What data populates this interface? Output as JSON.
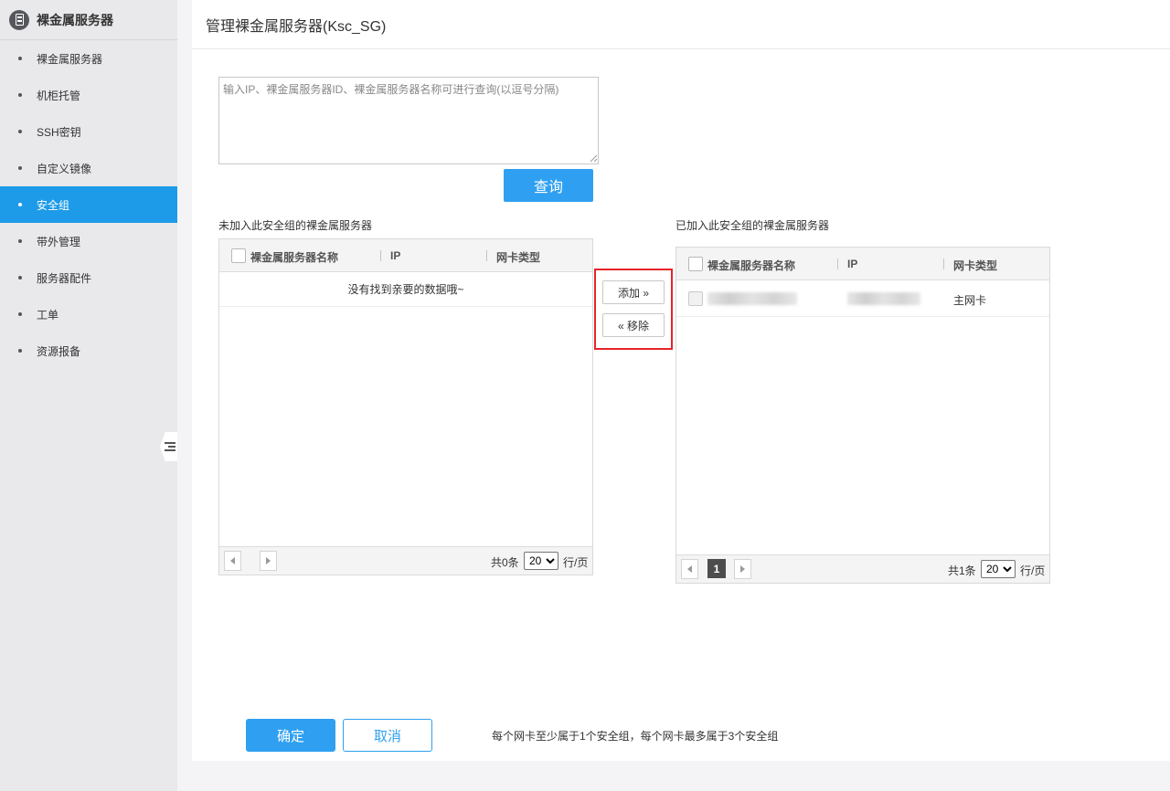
{
  "sidebar": {
    "logo_icon": "server-icon",
    "title": "裸金属服务器",
    "items": [
      {
        "label": "裸金属服务器",
        "active": false
      },
      {
        "label": "机柜托管",
        "active": false
      },
      {
        "label": "SSH密钥",
        "active": false
      },
      {
        "label": "自定义镜像",
        "active": false
      },
      {
        "label": "安全组",
        "active": true
      },
      {
        "label": "带外管理",
        "active": false
      },
      {
        "label": "服务器配件",
        "active": false
      },
      {
        "label": "工单",
        "active": false
      },
      {
        "label": "资源报备",
        "active": false
      }
    ]
  },
  "page": {
    "title": "管理裸金属服务器(Ksc_SG)"
  },
  "search": {
    "placeholder": "输入IP、裸金属服务器ID、裸金属服务器名称可进行查询(以逗号分隔)",
    "query_label": "查询"
  },
  "left_grid": {
    "title": "未加入此安全组的裸金属服务器",
    "columns": [
      "裸金属服务器名称",
      "IP",
      "网卡类型"
    ],
    "empty_text": "没有找到亲要的数据哦~",
    "total": "共0条",
    "page_size": "20",
    "unit": "行/页"
  },
  "transfer": {
    "add_label": "添加 »",
    "remove_label": "« 移除"
  },
  "right_grid": {
    "title": "已加入此安全组的裸金属服务器",
    "columns": [
      "裸金属服务器名称",
      "IP",
      "网卡类型"
    ],
    "rows": [
      {
        "name": "",
        "ip": "",
        "nic_type": "主网卡"
      }
    ],
    "current_page": "1",
    "total": "共1条",
    "page_size": "20",
    "unit": "行/页"
  },
  "footer": {
    "ok_label": "确定",
    "cancel_label": "取消",
    "hint": "每个网卡至少属于1个安全组，每个网卡最多属于3个安全组"
  },
  "colors": {
    "accent": "#2fa0f1",
    "active_nav": "#1e9be8",
    "highlight_border": "#e5242a"
  }
}
